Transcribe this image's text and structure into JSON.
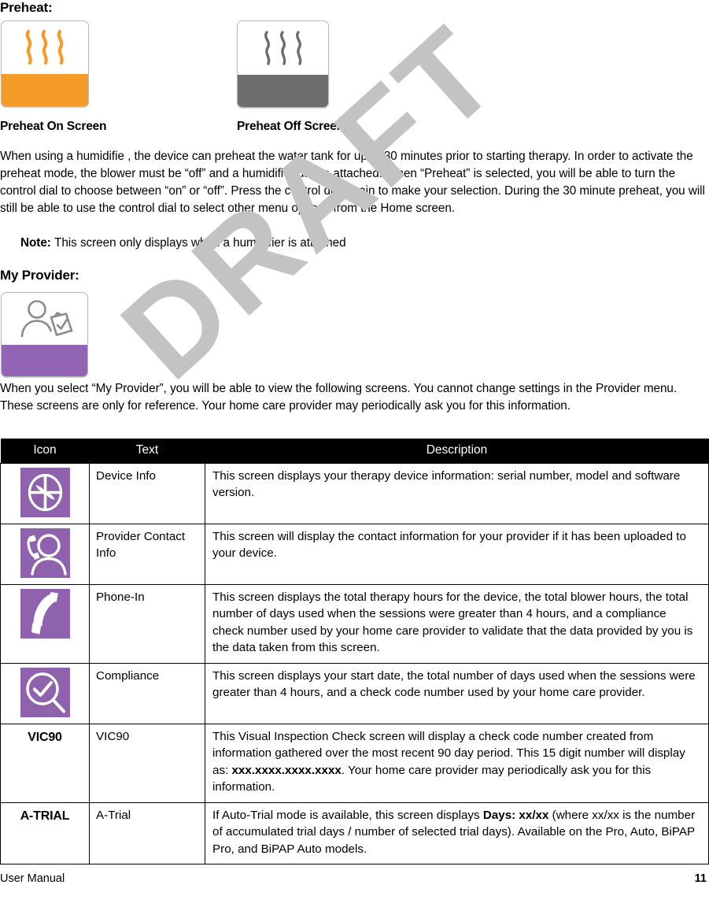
{
  "preheat": {
    "heading": "Preheat:",
    "tiles": [
      {
        "name": "preheat-on",
        "icon": "heat-waves-icon",
        "band_color": "#f59b2a",
        "wave_color": "#f59b2a",
        "caption": "Preheat On Screen"
      },
      {
        "name": "preheat-off",
        "icon": "heat-waves-icon",
        "band_color": "#6d6d6d",
        "wave_color": "#6d6d6d",
        "caption": "Preheat Off Screen"
      }
    ],
    "paragraph": "When using a humidifie , the device can preheat the water tank for up to 30 minutes prior to starting therapy. In order to activate the preheat mode, the blower must be “off” and a humidifier    ust be attached. When “Preheat” is selected, you will be able to turn the control dial to choose between “on” or “off”. Press the control dial again to make your selection. During the 30 minute preheat, you will still be able to use the control dial to select other menu options from the Home screen.",
    "note_label": "Note:",
    "note_text": "This screen only displays when a humidifier is attached"
  },
  "my_provider": {
    "heading": "My Provider:",
    "tile": {
      "icon": "person-clipboard-check-icon",
      "band_color": "#9164b4"
    },
    "paragraph": "When you select “My Provider”, you will be able to view the following screens. You cannot change settings in the Provider menu. These screens are only for reference. Your home care provider may periodically ask you for this information."
  },
  "table": {
    "headers": [
      "Icon",
      "Text",
      "Description"
    ],
    "icon_color": "#8f62ad",
    "rows": [
      {
        "icon_type": "graphic",
        "icon": "device-info-circle-cross-icon",
        "text": "Device Info",
        "description": "This screen displays your therapy device information: serial number, model and software version."
      },
      {
        "icon_type": "graphic",
        "icon": "person-phone-icon",
        "text": "Provider Contact Info",
        "description": "This screen will display the contact information for your provider if it has been uploaded to your device."
      },
      {
        "icon_type": "graphic",
        "icon": "phone-handset-icon",
        "text": "Phone-In",
        "description": "This screen displays the total therapy hours for the device, the total blower hours, the total number of days used when the sessions were greater than 4 hours, and a compliance check number used by your home care provider to validate that the data provided by you is the data taken from this screen."
      },
      {
        "icon_type": "graphic",
        "icon": "magnifier-check-icon",
        "text": "Compliance",
        "description": "This screen displays your start date, the total number of days used when the sessions were greater than 4 hours, and a check code number used by your home care provider."
      },
      {
        "icon_type": "label",
        "icon_label": "VIC90",
        "text": "VIC90",
        "description_parts": [
          {
            "text": "This Visual Inspection Check screen will display a check code number created from information gathered over the most recent 90 day period. This 15 digit number will display as: ",
            "bold": false
          },
          {
            "text": "xxx.xxxx.xxxx.xxxx",
            "bold": true
          },
          {
            "text": ". Your home care provider may periodically ask you for this information.",
            "bold": false
          }
        ]
      },
      {
        "icon_type": "label",
        "icon_label": "A-TRIAL",
        "text": "A-Trial",
        "description_parts": [
          {
            "text": "If Auto-Trial mode is available, this screen displays ",
            "bold": false
          },
          {
            "text": "Days: xx/xx",
            "bold": true
          },
          {
            "text": " (where xx/xx is the number of accumulated trial days / number of selected trial days). Available on the Pro, Auto, BiPAP Pro, and BiPAP Auto models.",
            "bold": false
          }
        ]
      }
    ]
  },
  "watermark": {
    "text": "DRAFT",
    "color": "#c3c3c3"
  },
  "footer": {
    "left": "User Manual",
    "right": "11"
  }
}
